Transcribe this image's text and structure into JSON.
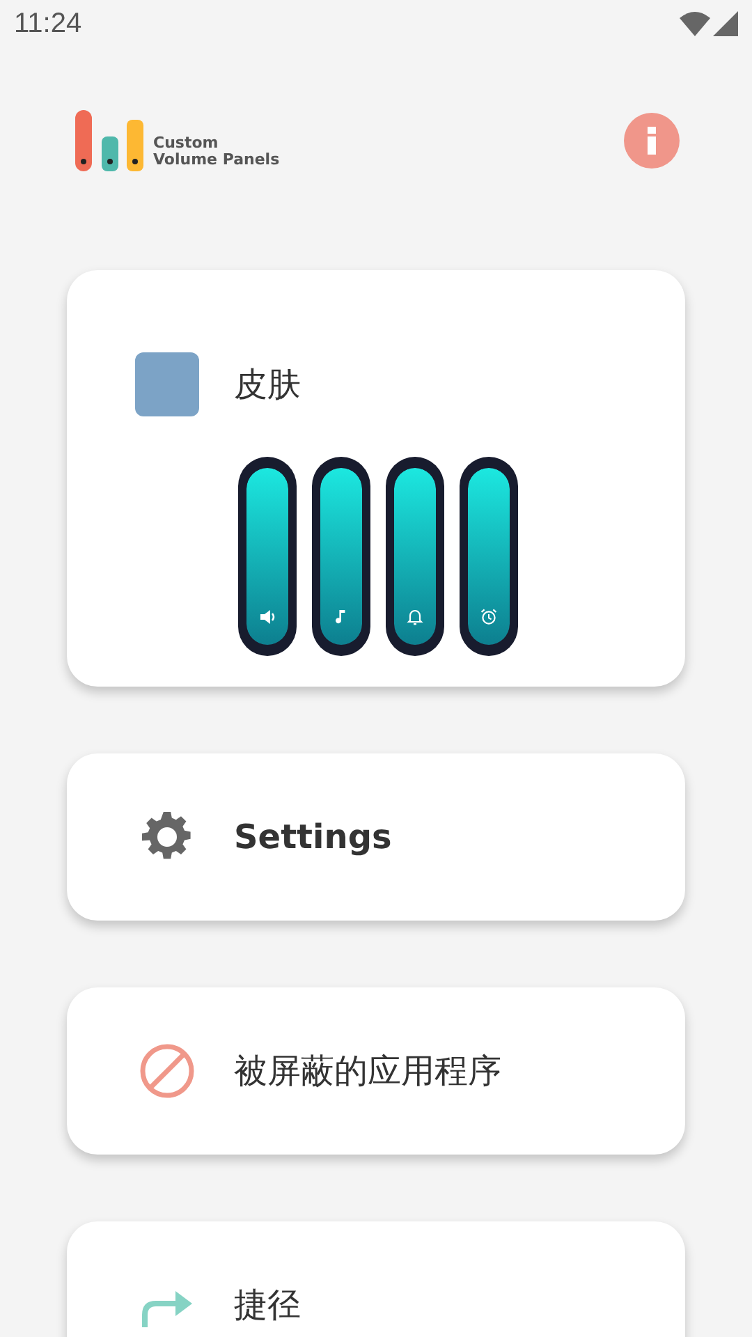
{
  "status_bar": {
    "time": "11:24"
  },
  "header": {
    "logo_line_1": "Custom",
    "logo_line_2": "Volume Panels"
  },
  "skin_card": {
    "title": "皮肤",
    "sliders": [
      {
        "kind": "volume",
        "level": 1
      },
      {
        "kind": "music",
        "level": 1
      },
      {
        "kind": "bell",
        "level": 1
      },
      {
        "kind": "alarm",
        "level": 1
      }
    ]
  },
  "menu": [
    {
      "kind": "settings",
      "label": "Settings"
    },
    {
      "kind": "blocked",
      "label": "被屏蔽的应用程序"
    },
    {
      "kind": "shortcut",
      "label": "捷径"
    }
  ]
}
